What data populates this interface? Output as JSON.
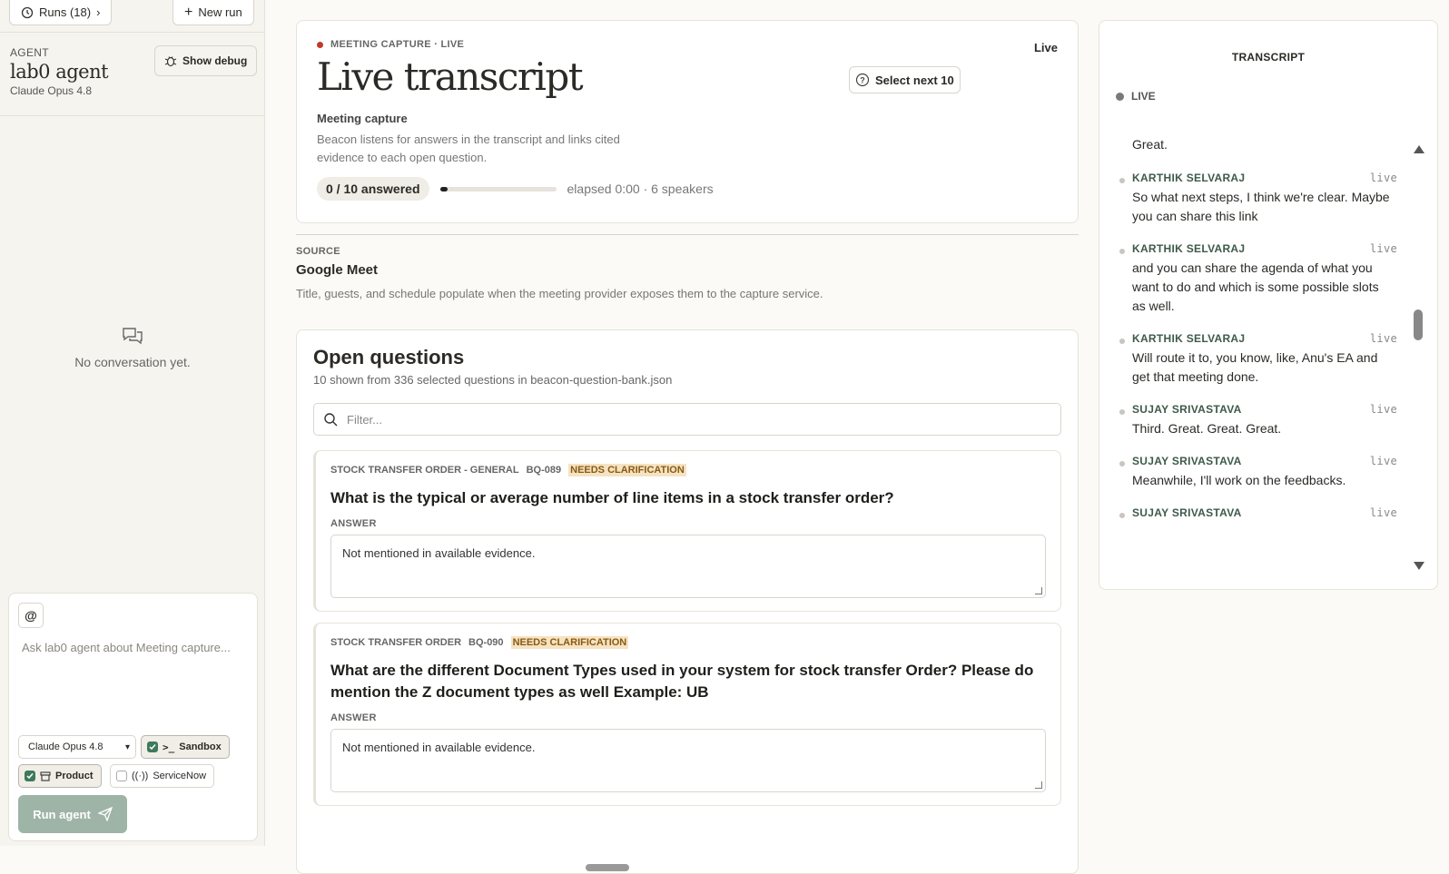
{
  "sidebar": {
    "runs_label": "Runs (18)",
    "new_run_label": "New run",
    "agent_kicker": "AGENT",
    "agent_name": "lab0 agent",
    "agent_model": "Claude Opus 4.8",
    "show_debug_label": "Show debug",
    "empty_conversation": "No conversation yet.",
    "composer": {
      "at_label": "@",
      "placeholder": "Ask lab0 agent about Meeting capture...",
      "model_select": "Claude Opus 4.8",
      "sandbox_label": "Sandbox",
      "product_label": "Product",
      "servicenow_label": "ServiceNow",
      "run_label": "Run agent"
    }
  },
  "hero": {
    "kicker": "MEETING CAPTURE · LIVE",
    "title": "Live transcript",
    "live_label": "Live",
    "select_next_label": "Select next 10",
    "subtitle": "Meeting capture",
    "description": "Beacon listens for answers in the transcript and links cited evidence to each open question.",
    "answered": "0 / 10 answered",
    "progress_fraction": 0.07,
    "elapsed": "elapsed 0:00 · 6 speakers"
  },
  "source": {
    "kicker": "SOURCE",
    "name": "Google Meet",
    "description": "Title, guests, and schedule populate when the meeting provider exposes them to the capture service."
  },
  "open_questions": {
    "title": "Open questions",
    "subtitle": "10 shown from 336 selected questions in beacon-question-bank.json",
    "filter_placeholder": "Filter...",
    "answer_label": "ANSWER",
    "questions": [
      {
        "category": "STOCK TRANSFER ORDER - GENERAL",
        "id": "BQ-089",
        "status": "NEEDS CLARIFICATION",
        "text": "What is the typical or average number of line items in a stock transfer order?",
        "answer": "Not mentioned in available evidence."
      },
      {
        "category": "STOCK TRANSFER ORDER",
        "id": "BQ-090",
        "status": "NEEDS CLARIFICATION",
        "text": "What are the different Document Types used in your system for stock transfer Order? Please do mention the Z document types as well Example: UB",
        "answer": "Not mentioned in available evidence."
      }
    ]
  },
  "transcript": {
    "title": "TRANSCRIPT",
    "live_label": "LIVE",
    "first_line": "Great.",
    "utterances": [
      {
        "speaker": "KARTHIK SELVARAJ",
        "tag": "live",
        "text": "So what next steps, I think we're clear. Maybe you can share this link"
      },
      {
        "speaker": "KARTHIK SELVARAJ",
        "tag": "live",
        "text": "and you can share the agenda of what you want to do and which is some possible slots as well."
      },
      {
        "speaker": "KARTHIK SELVARAJ",
        "tag": "live",
        "text": "Will route it to, you know, like, Anu's EA and get that meeting done."
      },
      {
        "speaker": "SUJAY SRIVASTAVA",
        "tag": "live",
        "text": "Third. Great. Great. Great."
      },
      {
        "speaker": "SUJAY SRIVASTAVA",
        "tag": "live",
        "text": "Meanwhile, I'll work on the feedbacks."
      },
      {
        "speaker": "SUJAY SRIVASTAVA",
        "tag": "live",
        "text": ""
      }
    ]
  },
  "colors": {
    "accent_green": "#3d7a5a",
    "live_red": "#c0392b",
    "warn_badge_bg": "#f5e3c2"
  }
}
